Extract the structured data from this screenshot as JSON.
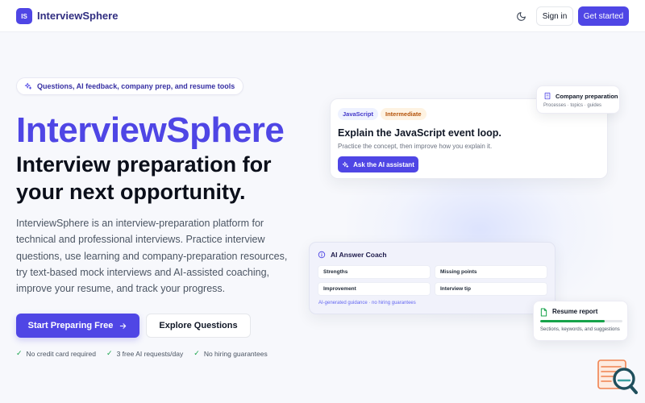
{
  "nav": {
    "logo_badge": "IS",
    "brand": "InterviewSphere",
    "theme_toggle_icon": "moon-icon",
    "signin_label": "Sign in",
    "get_started_label": "Get started"
  },
  "hero": {
    "pill_text": "Questions, AI feedback, company prep, and resume tools",
    "title": "InterviewSphere",
    "subtitle": "Interview preparation for your next opportunity.",
    "description": "InterviewSphere is an interview-preparation platform for technical and professional interviews. Practice interview questions, use learning and company-preparation resources, try text-based mock interviews and AI-assisted coaching, improve your resume, and track your progress.",
    "primary_cta": "Start Preparing Free",
    "secondary_cta": "Explore Questions",
    "assurances": [
      "No credit card required",
      "3 free AI requests/day",
      "No hiring guarantees"
    ]
  },
  "question_card": {
    "tag_language": "JavaScript",
    "tag_level": "Intermediate",
    "title": "Explain the JavaScript event loop.",
    "hint": "Practice the concept, then improve how you explain it.",
    "button": "Ask the AI assistant"
  },
  "company_card": {
    "title": "Company preparation",
    "subtitle": "Processes · topics · guides"
  },
  "coach_card": {
    "title": "AI Answer Coach",
    "cells": [
      "Strengths",
      "Missing points",
      "Improvement",
      "Interview tip"
    ],
    "footnote": "AI-generated guidance · no hiring guarantees"
  },
  "resume_card": {
    "title": "Resume report",
    "progress": 0.78,
    "subtitle": "Sections, keywords, and suggestions"
  },
  "colors": {
    "accent": "#4f46e5",
    "success": "#16a34a",
    "warning_tag": "#b45309"
  }
}
